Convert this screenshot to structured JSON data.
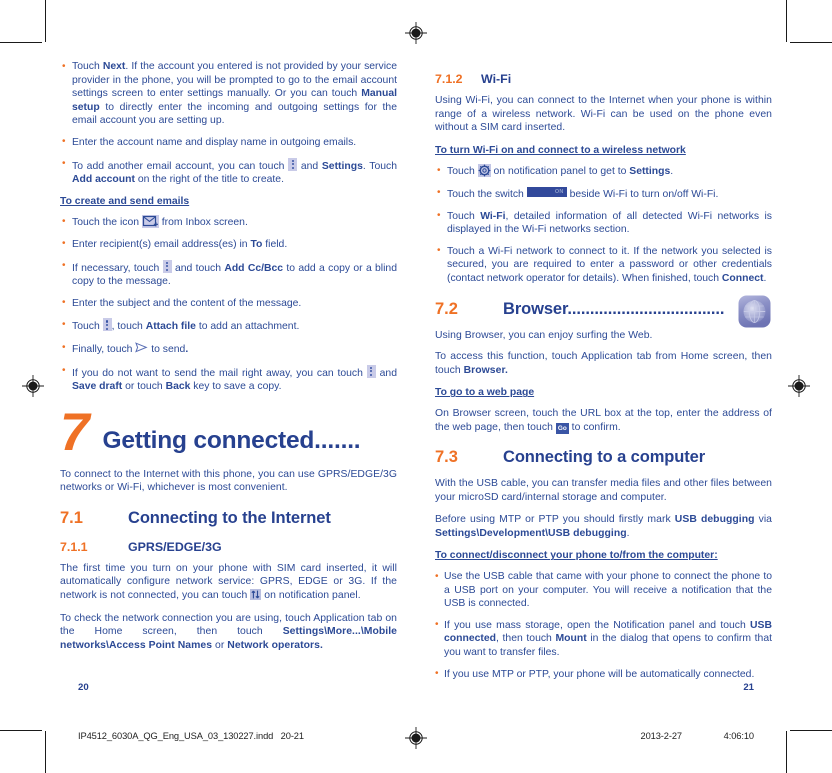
{
  "document": {
    "left_page": {
      "page_number": "20",
      "bullets_top": [
        {
          "runs": [
            {
              "t": "Touch ",
              "b": false
            },
            {
              "t": "Next",
              "b": true
            },
            {
              "t": ". If the account you entered is not provided by your service provider in the phone, you will be prompted to go to the email account settings screen to enter settings manually. Or you can touch ",
              "b": false
            },
            {
              "t": "Manual setup",
              "b": true
            },
            {
              "t": " to directly enter the incoming and outgoing settings for the email account you are setting up.",
              "b": false
            }
          ]
        },
        {
          "runs": [
            {
              "t": "Enter the account name and display name in outgoing emails.",
              "b": false
            }
          ]
        },
        {
          "runs": [
            {
              "t": "To add another email account, you can touch ",
              "b": false
            },
            {
              "icon": "kebab-menu-icon"
            },
            {
              "t": " and ",
              "b": false
            },
            {
              "t": "Settings",
              "b": true
            },
            {
              "t": ". Touch ",
              "b": false
            },
            {
              "t": "Add account",
              "b": true
            },
            {
              "t": " on the right of the title to create.",
              "b": false
            }
          ]
        }
      ],
      "subheading": "To create and send emails",
      "bullets_mid": [
        {
          "runs": [
            {
              "t": "Touch the icon ",
              "b": false
            },
            {
              "icon": "new-mail-icon"
            },
            {
              "t": " from Inbox screen.",
              "b": false
            }
          ]
        },
        {
          "runs": [
            {
              "t": "Enter recipient(s) email address(es) in ",
              "b": false
            },
            {
              "t": "To",
              "b": true
            },
            {
              "t": " field.",
              "b": false
            }
          ]
        },
        {
          "runs": [
            {
              "t": "If necessary, touch ",
              "b": false
            },
            {
              "icon": "kebab-menu-icon"
            },
            {
              "t": " and touch ",
              "b": false
            },
            {
              "t": "Add Cc/Bcc",
              "b": true
            },
            {
              "t": " to add a copy or a blind copy to the message.",
              "b": false
            }
          ]
        },
        {
          "runs": [
            {
              "t": "Enter the subject and the content of the message.",
              "b": false
            }
          ]
        },
        {
          "runs": [
            {
              "t": "Touch ",
              "b": false
            },
            {
              "icon": "kebab-menu-icon"
            },
            {
              "t": ", touch ",
              "b": false
            },
            {
              "t": "Attach file",
              "b": true
            },
            {
              "t": " to add an attachment.",
              "b": false
            }
          ]
        },
        {
          "runs": [
            {
              "t": "Finally, touch ",
              "b": false
            },
            {
              "icon": "send-icon"
            },
            {
              "t": " to send",
              "b": false
            },
            {
              "t": ".",
              "b": true
            }
          ]
        },
        {
          "runs": [
            {
              "t": "If you do not want to send the mail right away, you can touch ",
              "b": false
            },
            {
              "icon": "kebab-menu-icon"
            },
            {
              "t": " and ",
              "b": false
            },
            {
              "t": "Save draft",
              "b": true
            },
            {
              "t": " or touch ",
              "b": false
            },
            {
              "t": "Back",
              "b": true
            },
            {
              "t": " key to save a copy.",
              "b": false
            }
          ]
        }
      ],
      "chapter": {
        "number": "7",
        "title": "Getting connected......."
      },
      "intro": {
        "runs": [
          {
            "t": "To connect to the Internet with this phone, you can use GPRS/EDGE/3G networks or Wi-Fi, whichever is most convenient.",
            "b": false
          }
        ]
      },
      "h2_1": {
        "number": "7.1",
        "title": "Connecting to the Internet"
      },
      "h3_1": {
        "number": "7.1.1",
        "title": "GPRS/EDGE/3G"
      },
      "para_gprs_1": {
        "runs": [
          {
            "t": "The first time you turn on your phone with SIM card inserted, it will automatically configure network service: GPRS, EDGE or 3G. If the network is not connected, you can touch ",
            "b": false
          },
          {
            "icon": "network-data-icon"
          },
          {
            "t": " on notification panel.",
            "b": false
          }
        ]
      },
      "para_gprs_2": {
        "runs": [
          {
            "t": "To check the network connection you are using, touch Application tab on the Home screen, then touch ",
            "b": false
          },
          {
            "t": "Settings\\More...\\Mobile networks\\Access Point Names",
            "b": true
          },
          {
            "t": " or ",
            "b": false
          },
          {
            "t": "Network operators.",
            "b": true
          }
        ]
      }
    },
    "right_page": {
      "page_number": "21",
      "h3_wifi": {
        "number": "7.1.2",
        "title": "Wi-Fi"
      },
      "para_wifi_intro": {
        "runs": [
          {
            "t": "Using Wi-Fi, you can connect to the Internet when your phone is within range of a wireless network. Wi-Fi can be used on the phone even without a SIM card inserted.",
            "b": false
          }
        ]
      },
      "subheading_wifi": "To turn Wi-Fi on and connect to a wireless network",
      "bullets_wifi": [
        {
          "runs": [
            {
              "t": "Touch ",
              "b": false
            },
            {
              "icon": "settings-gear-icon"
            },
            {
              "t": " on notification panel to get to ",
              "b": false
            },
            {
              "t": "Settings",
              "b": true
            },
            {
              "t": ".",
              "b": false
            }
          ]
        },
        {
          "runs": [
            {
              "t": "Touch the switch ",
              "b": false
            },
            {
              "icon": "toggle-switch-on-icon"
            },
            {
              "t": " beside Wi-Fi to  turn on/off Wi-Fi.",
              "b": false
            }
          ]
        },
        {
          "runs": [
            {
              "t": "Touch ",
              "b": false
            },
            {
              "t": "Wi-Fi",
              "b": true
            },
            {
              "t": ", detailed information of all detected Wi-Fi networks is displayed in the Wi-Fi networks section.",
              "b": false
            }
          ]
        },
        {
          "runs": [
            {
              "t": "Touch a Wi-Fi network to connect to it. If the network you selected is secured, you are required to enter a password or other credentials (contact network operator for details). When finished, touch ",
              "b": false
            },
            {
              "t": "Connect",
              "b": true
            },
            {
              "t": ".",
              "b": false
            }
          ]
        }
      ],
      "h2_browser": {
        "number": "7.2",
        "title": "Browser...................................",
        "icon": "browser-globe-icon"
      },
      "para_browser_1": {
        "runs": [
          {
            "t": "Using Browser, you can enjoy surfing the Web.",
            "b": false
          }
        ]
      },
      "para_browser_2": {
        "runs": [
          {
            "t": "To access this function, touch Application tab from Home screen, then touch ",
            "b": false
          },
          {
            "t": "Browser.",
            "b": true
          }
        ]
      },
      "subheading_webpage": "To go to a web page",
      "para_webpage": {
        "runs": [
          {
            "t": "On Browser screen, touch the URL box at the top, enter the address of the web page, then touch ",
            "b": false
          },
          {
            "icon": "go-button-icon"
          },
          {
            "t": " to confirm.",
            "b": false
          }
        ]
      },
      "h2_computer": {
        "number": "7.3",
        "title": "Connecting to a computer"
      },
      "para_computer_1": {
        "runs": [
          {
            "t": "With the USB cable, you can transfer media files and other files between your microSD card/internal storage and computer.",
            "b": false
          }
        ]
      },
      "para_computer_2": {
        "runs": [
          {
            "t": "Before using MTP or PTP you should firstly mark ",
            "b": false
          },
          {
            "t": "USB debugging",
            "b": true
          },
          {
            "t": " via ",
            "b": false
          },
          {
            "t": "Settings\\Development\\USB debugging",
            "b": true
          },
          {
            "t": ".",
            "b": false
          }
        ]
      },
      "subheading_connect": "To connect/disconnect your phone to/from the computer:",
      "bullets_connect": [
        {
          "runs": [
            {
              "t": "Use the USB cable that came with your phone to connect the phone to a USB port on your computer. You will receive a notification that the USB is connected.",
              "b": false
            }
          ]
        },
        {
          "runs": [
            {
              "t": "If you use mass storage, open the Notification panel and touch ",
              "b": false
            },
            {
              "t": "USB connected",
              "b": true
            },
            {
              "t": ", then touch ",
              "b": false
            },
            {
              "t": "Mount",
              "b": true
            },
            {
              "t": " in the dialog that opens to confirm that you want to transfer files.",
              "b": false
            }
          ]
        },
        {
          "runs": [
            {
              "t": "If you use MTP or PTP, your phone will be automatically connected.",
              "b": false
            }
          ]
        }
      ]
    },
    "imprint": {
      "filename": "IP4512_6030A_QG_Eng_USA_03_130227.indd",
      "spread": "20-21",
      "date": "2013-2-27",
      "time": "4:06:10"
    }
  },
  "colors": {
    "body_blue": "#2c4a96",
    "heading_blue": "#27418f",
    "accent_orange": "#ef7125",
    "bullet_orange": "#ef7125",
    "icon_lavender": "#c9cbe8",
    "switch_blue": "#32499b"
  }
}
